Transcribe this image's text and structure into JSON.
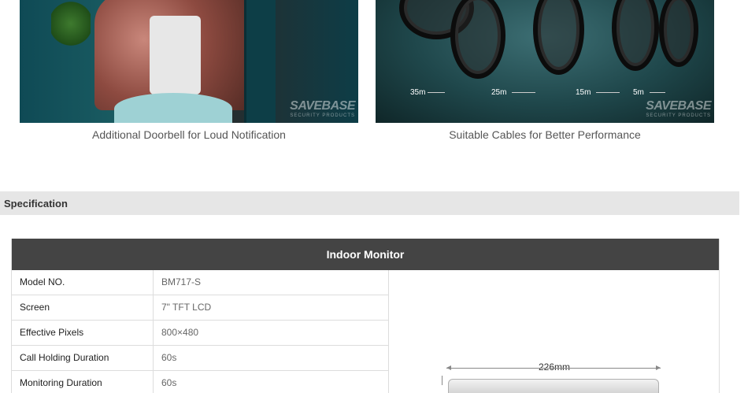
{
  "gallery": [
    {
      "caption": "Additional Doorbell for Loud Notification",
      "watermark": "SAVEBASE",
      "watermark_sub": "SECURITY PRODUCTS"
    },
    {
      "caption": "Suitable Cables for Better Performance",
      "watermark": "SAVEBASE",
      "watermark_sub": "SECURITY PRODUCTS",
      "cable_lengths": [
        "35m",
        "25m",
        "15m",
        "5m"
      ]
    }
  ],
  "specification": {
    "section_title": "Specification",
    "table_title": "Indoor Monitor",
    "rows": [
      {
        "label": "Model NO.",
        "value": "BM717-S"
      },
      {
        "label": "Screen",
        "value": "7\" TFT LCD"
      },
      {
        "label": "Effective Pixels",
        "value": "800×480"
      },
      {
        "label": "Call Holding Duration",
        "value": "60s"
      },
      {
        "label": "Monitoring Duration",
        "value": "60s"
      }
    ],
    "drawing": {
      "width_label": "226mm"
    }
  },
  "colors": {
    "table_header_bg": "#444444",
    "section_bar_bg": "#e6e6e6",
    "caption_text": "#555555"
  }
}
